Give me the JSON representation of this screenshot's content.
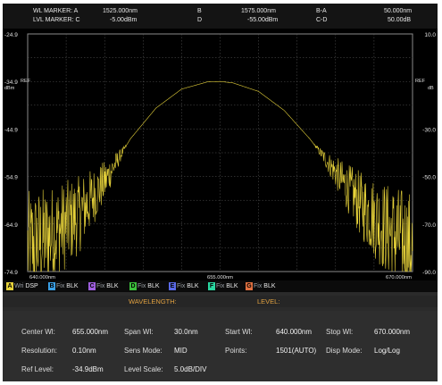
{
  "markers": {
    "wl_marker_a_label": "WL MARKER: A",
    "wl_marker_a_value": "1525.000nm",
    "b_label": "B",
    "b_value": "1575.000nm",
    "ba_label": "B-A",
    "ba_value": "50.000nm",
    "lvl_marker_c_label": "LVL MARKER: C",
    "lvl_marker_c_value": "-5.00dBm",
    "d_label": "D",
    "d_value": "-55.00dBm",
    "cd_label": "C-D",
    "cd_value": "50.00dB"
  },
  "plot": {
    "left_ticks": [
      "-24.9",
      "-34.9",
      "-44.9",
      "-54.9",
      "-64.9",
      "-74.9"
    ],
    "left_ref": "REF",
    "left_unit": "dBm",
    "right_ticks": [
      "10.0",
      "",
      "-30.0",
      "-50.0",
      "-70.0",
      "-90.0"
    ],
    "right_ref": "REF",
    "right_unit": "dB",
    "x_start": "640.000nm",
    "x_center": "655.000nm",
    "x_stop": "670.000nm",
    "trace_color": "#e6d23a",
    "grid_color": "#5a5a5a"
  },
  "chart_data": {
    "type": "line",
    "title": "",
    "xlabel": "",
    "ylabel": "dBm",
    "xlim": [
      640,
      670
    ],
    "ylim": [
      -74.9,
      -24.9
    ],
    "series": [
      {
        "x": [
          640,
          642,
          644,
          646,
          648,
          650,
          652,
          654,
          655,
          656,
          658,
          660,
          662,
          664,
          666,
          668,
          670
        ],
        "y": [
          -70,
          -67,
          -63,
          -56,
          -47,
          -40.5,
          -36.5,
          -35,
          -34.9,
          -35.2,
          -37,
          -41,
          -47,
          -54,
          -61,
          -66,
          -70
        ]
      }
    ]
  },
  "traces": [
    {
      "key": "A",
      "mode": "Wri",
      "state": "DSP",
      "color": "#e6d23a"
    },
    {
      "key": "B",
      "mode": "Fix",
      "state": "BLK",
      "color": "#3aa0e6"
    },
    {
      "key": "C",
      "mode": "Fix",
      "state": "BLK",
      "color": "#a060e0"
    },
    {
      "key": "D",
      "mode": "Fix",
      "state": "BLK",
      "color": "#3cc03c"
    },
    {
      "key": "E",
      "mode": "Fix",
      "state": "BLK",
      "color": "#5a6ae8"
    },
    {
      "key": "F",
      "mode": "Fix",
      "state": "BLK",
      "color": "#2ad6a0"
    },
    {
      "key": "G",
      "mode": "Fix",
      "state": "BLK",
      "color": "#e07040"
    }
  ],
  "wl_bar": {
    "wavelength_label": "WAVELENGTH:",
    "level_label": "LEVEL:"
  },
  "params": {
    "center_wl_label": "Center Wl:",
    "center_wl_value": "655.000nm",
    "span_wl_label": "Span Wl:",
    "span_wl_value": "30.0nm",
    "start_wl_label": "Start Wl:",
    "start_wl_value": "640.000nm",
    "stop_wl_label": "Stop Wl:",
    "stop_wl_value": "670.000nm",
    "resolution_label": "Resolution:",
    "resolution_value": "0.10nm",
    "sens_mode_label": "Sens Mode:",
    "sens_mode_value": "MID",
    "points_label": "Points:",
    "points_value": "1501(AUTO)",
    "disp_mode_label": "Disp Mode:",
    "disp_mode_value": "Log/Log",
    "ref_level_label": "Ref Level:",
    "ref_level_value": "-34.9dBm",
    "level_scale_label": "Level Scale:",
    "level_scale_value": "5.0dB/DIV"
  }
}
